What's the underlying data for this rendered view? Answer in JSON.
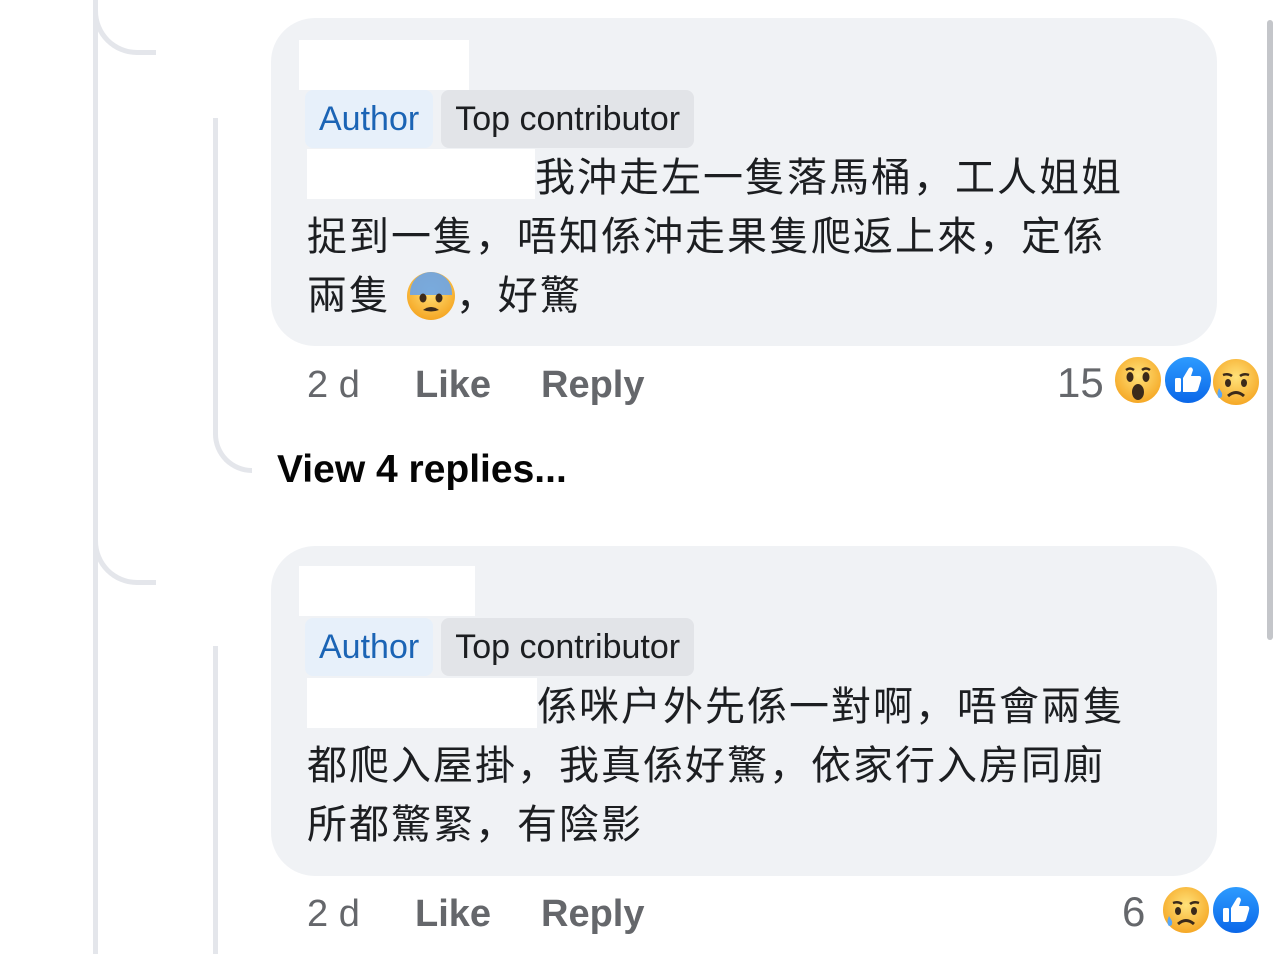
{
  "comments": [
    {
      "badges": {
        "author": "Author",
        "top": "Top contributor"
      },
      "text_lines": [
        "我沖走左一隻落馬桶，工人姐姐",
        "捉到一隻，唔知係沖走果隻爬返上來，定係",
        "兩隻",
        "，好驚"
      ],
      "inline_emoji": "fearful-face",
      "time": "2 d",
      "like": "Like",
      "reply": "Reply",
      "reaction_count": "15",
      "reactions": [
        "wow",
        "like",
        "sad"
      ]
    },
    {
      "badges": {
        "author": "Author",
        "top": "Top contributor"
      },
      "text_lines": [
        "係咪户外先係一對啊，唔會兩隻",
        "都爬入屋掛，我真係好驚，依家行入房同廁",
        "所都驚緊，有陰影"
      ],
      "time": "2 d",
      "like": "Like",
      "reply": "Reply",
      "reaction_count": "6",
      "reactions": [
        "sad",
        "like"
      ]
    }
  ],
  "view_replies": "View 4 replies...",
  "colors": {
    "bubble": "#f0f2f5",
    "author_badge_text": "#1b64b5",
    "like_blue": "#1877f2",
    "emoji_yellow": "#f7b125"
  }
}
